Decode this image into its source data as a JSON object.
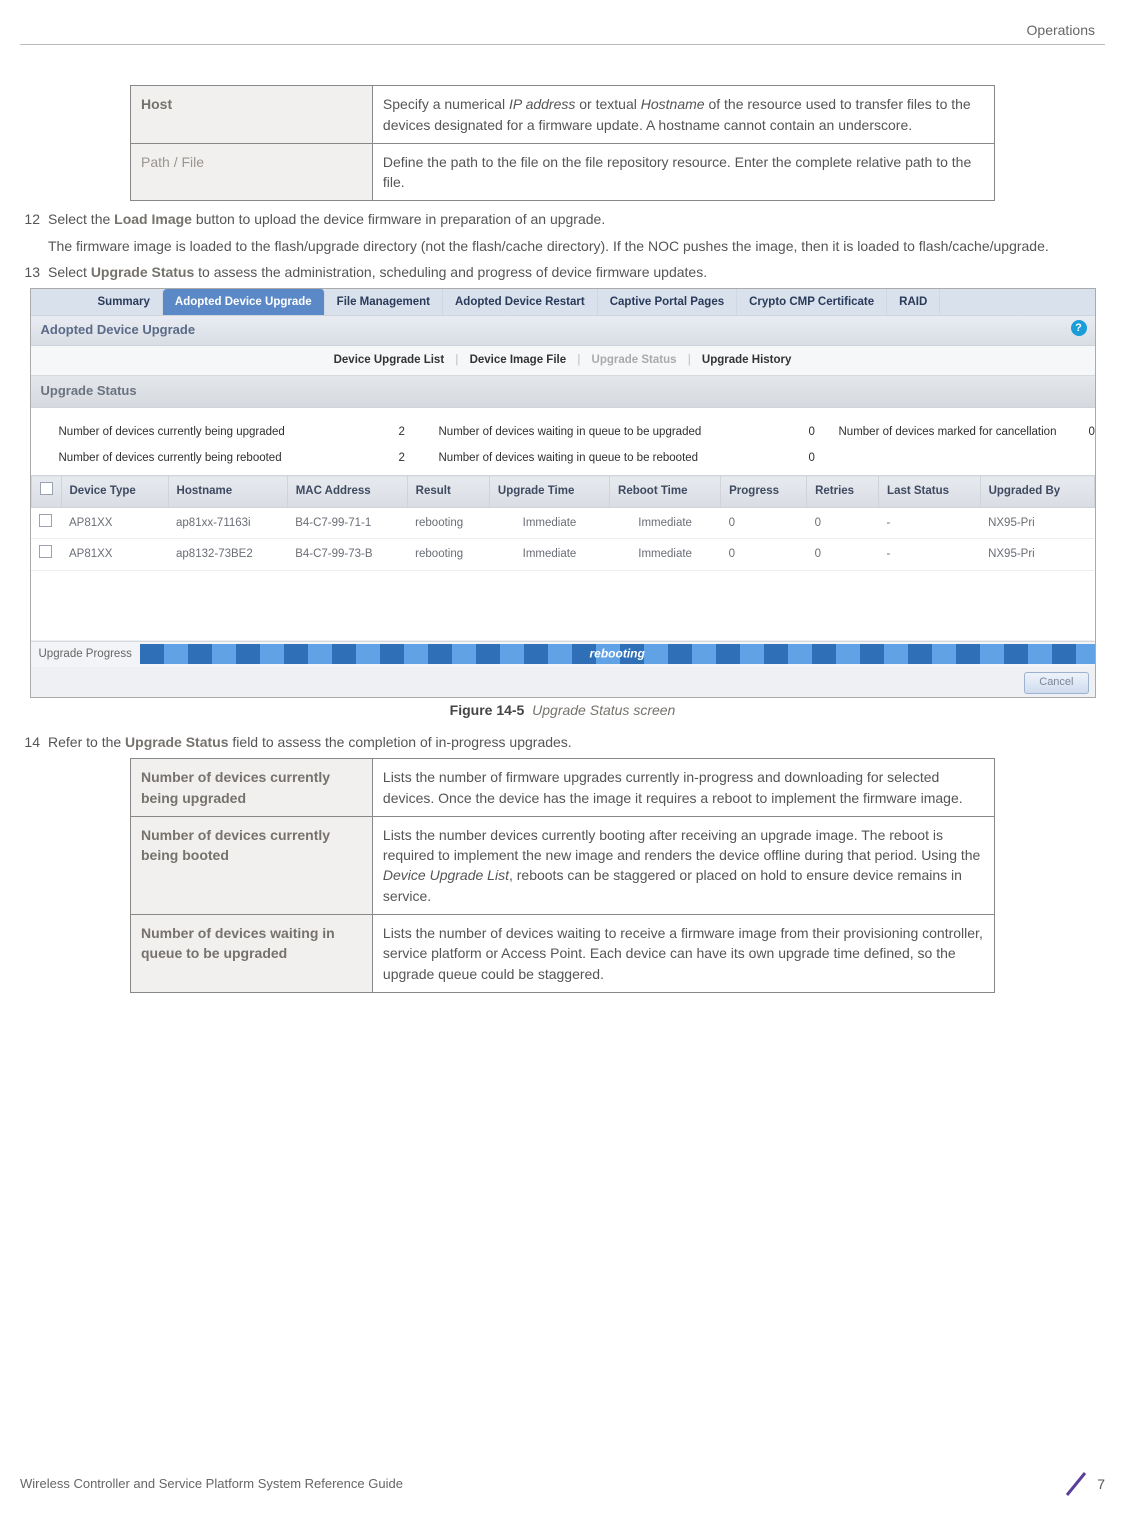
{
  "header": {
    "section": "Operations"
  },
  "tables": {
    "top": [
      {
        "label": "Host",
        "desc_prefix": "Specify a numerical ",
        "desc_italic1": "IP address",
        "desc_mid": " or textual ",
        "desc_italic2": "Hostname",
        "desc_suffix": " of the resource used to transfer files to the devices designated for a firmware update. A hostname cannot contain an underscore."
      },
      {
        "label": "Path / File",
        "desc": "Define the path to the file on the file repository resource. Enter the complete relative path to the file."
      }
    ],
    "bottom": [
      {
        "label": "Number of devices currently being upgraded",
        "desc": "Lists the number of firmware upgrades currently in-progress and downloading for selected devices. Once the device has the image it requires a reboot to implement the firmware image."
      },
      {
        "label": "Number of devices currently being booted",
        "desc_prefix": "Lists the number devices currently booting after receiving an upgrade image. The reboot is required to implement the new image and renders the device offline during that period. Using the ",
        "desc_italic": "Device Upgrade List",
        "desc_suffix": ", reboots can be staggered or placed on hold to ensure device remains in service."
      },
      {
        "label": "Number of devices waiting in queue to be upgraded",
        "desc": "Lists the number of devices waiting to receive a firmware image from their provisioning controller, service platform or Access Point. Each device can have its own upgrade time defined, so the upgrade queue could be staggered."
      }
    ]
  },
  "steps": {
    "s12": {
      "num": "12",
      "prefix": "Select the ",
      "bold": "Load Image",
      "suffix": " button to upload the device firmware in preparation of an upgrade.",
      "para2": "The firmware image is loaded to the flash/upgrade directory (not the flash/cache directory). If the NOC pushes the image, then it is loaded to flash/cache/upgrade."
    },
    "s13": {
      "num": "13",
      "prefix": "Select ",
      "bold": "Upgrade Status",
      "suffix": " to assess the administration, scheduling and progress of device firmware updates."
    },
    "s14": {
      "num": "14",
      "prefix": "Refer to the ",
      "bold": "Upgrade Status",
      "suffix": " field to assess the completion of in-progress upgrades."
    }
  },
  "figure": {
    "label": "Figure 14-5",
    "text": "Upgrade Status screen"
  },
  "screenshot": {
    "tabs": [
      "Summary",
      "Adopted Device Upgrade",
      "File Management",
      "Adopted Device Restart",
      "Captive Portal Pages",
      "Crypto CMP Certificate",
      "RAID"
    ],
    "active_tab_index": 1,
    "panel_title": "Adopted Device Upgrade",
    "help_icon": "?",
    "subtabs": {
      "a": "Device Upgrade List",
      "b": "Device Image File",
      "c": "Upgrade Status",
      "d": "Upgrade History"
    },
    "section_head": "Upgrade Status",
    "stats": {
      "l1a": "Number of devices currently being upgraded",
      "v1a": "2",
      "l1b": "Number of devices waiting in queue to be upgraded",
      "v1b": "0",
      "l1c": "Number of devices marked for cancellation",
      "v1c": "0",
      "l2a": "Number of devices currently being rebooted",
      "v2a": "2",
      "l2b": "Number of devices waiting in queue to be rebooted",
      "v2b": "0"
    },
    "columns": [
      "",
      "Device Type",
      "Hostname",
      "MAC Address",
      "Result",
      "Upgrade Time",
      "Reboot Time",
      "Progress",
      "Retries",
      "Last Status",
      "Upgraded By"
    ],
    "rows": [
      {
        "type": "AP81XX",
        "host": "ap81xx-71163i",
        "mac": "B4-C7-99-71-1",
        "result": "rebooting",
        "utime": "Immediate",
        "rtime": "Immediate",
        "prog": "0",
        "ret": "0",
        "last": "-",
        "by": "NX95-Pri"
      },
      {
        "type": "AP81XX",
        "host": "ap8132-73BE2",
        "mac": "B4-C7-99-73-B",
        "result": "rebooting",
        "utime": "Immediate",
        "rtime": "Immediate",
        "prog": "0",
        "ret": "0",
        "last": "-",
        "by": "NX95-Pri"
      }
    ],
    "progress_label": "Upgrade Progress",
    "progress_text": "rebooting",
    "cancel": "Cancel"
  },
  "footer": {
    "left": "Wireless Controller and Service Platform System Reference Guide",
    "page": "7"
  }
}
